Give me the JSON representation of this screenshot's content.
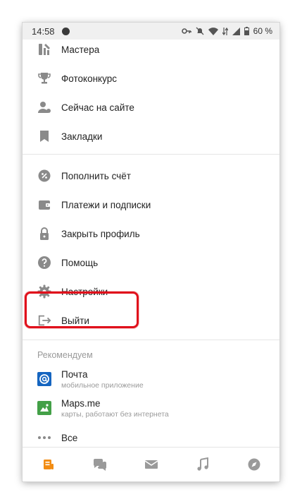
{
  "status_bar": {
    "time": "14:58",
    "battery": "60 %"
  },
  "menu": {
    "group1": [
      {
        "label": "Мастера",
        "icon": "craft-tools-icon"
      },
      {
        "label": "Фотоконкурс",
        "icon": "trophy-icon"
      },
      {
        "label": "Сейчас на сайте",
        "icon": "online-users-icon"
      },
      {
        "label": "Закладки",
        "icon": "bookmark-icon"
      }
    ],
    "group2": [
      {
        "label": "Пополнить счёт",
        "icon": "top-up-icon"
      },
      {
        "label": "Платежи и подписки",
        "icon": "wallet-icon"
      },
      {
        "label": "Закрыть профиль",
        "icon": "lock-icon"
      },
      {
        "label": "Помощь",
        "icon": "help-icon"
      },
      {
        "label": "Настройки",
        "icon": "gear-icon"
      },
      {
        "label": "Выйти",
        "icon": "logout-icon"
      }
    ]
  },
  "recommended": {
    "title": "Рекомендуем",
    "apps": [
      {
        "name": "Почта",
        "description": "мобильное приложение",
        "icon": "mail-app-icon",
        "color": "#1565c0"
      },
      {
        "name": "Maps.me",
        "description": "карты, работают без интернета",
        "icon": "mapsme-app-icon",
        "color": "#43a047"
      }
    ],
    "all_label": "Все"
  },
  "bottom_nav": {
    "active_color": "#f28c13",
    "items": [
      "feed-icon",
      "messages-icon",
      "mail-icon",
      "music-icon",
      "discover-icon"
    ]
  },
  "highlight_color": "#e0101b"
}
